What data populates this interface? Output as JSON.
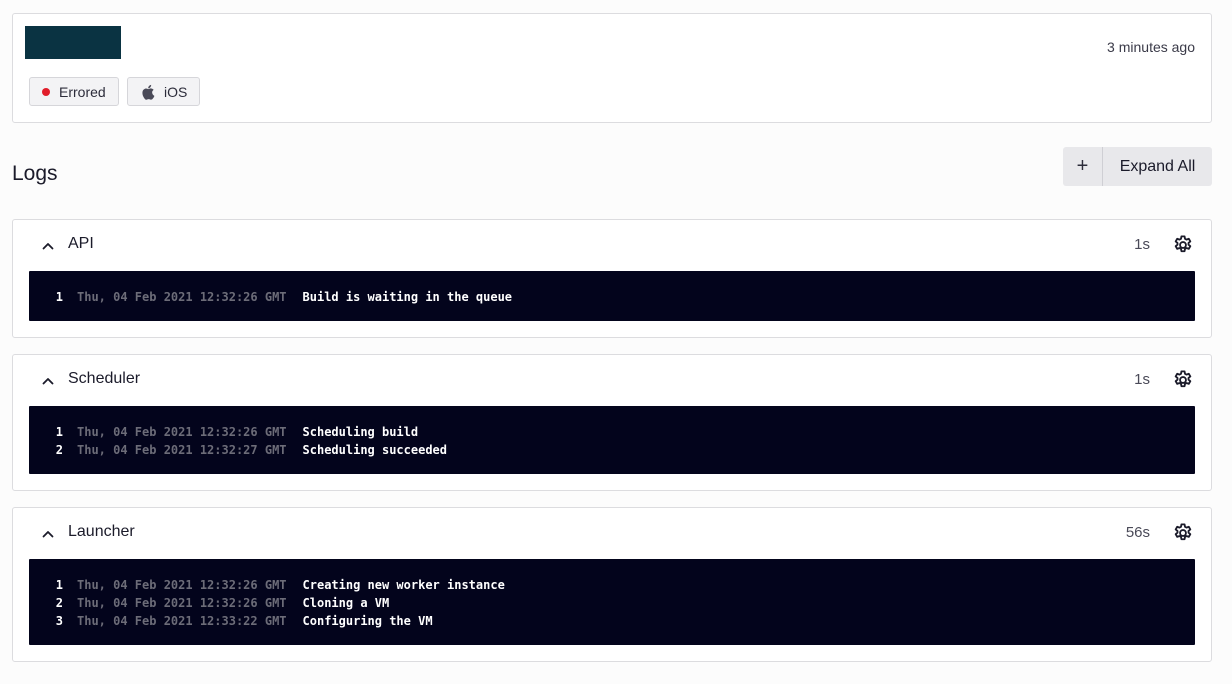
{
  "header": {
    "timestamp": "3 minutes ago",
    "status_badge": {
      "label": "Errored",
      "color": "#e11d2a"
    },
    "platform_badge": {
      "label": "iOS",
      "icon": "apple-icon"
    }
  },
  "logs": {
    "title": "Logs",
    "expand_all": {
      "icon": "+",
      "label": "Expand All"
    }
  },
  "sections": [
    {
      "title": "API",
      "duration": "1s",
      "lines": [
        {
          "num": "1",
          "time": "Thu, 04 Feb 2021 12:32:26 GMT",
          "message": "Build is waiting in the queue"
        }
      ]
    },
    {
      "title": "Scheduler",
      "duration": "1s",
      "lines": [
        {
          "num": "1",
          "time": "Thu, 04 Feb 2021 12:32:26 GMT",
          "message": "Scheduling build"
        },
        {
          "num": "2",
          "time": "Thu, 04 Feb 2021 12:32:27 GMT",
          "message": "Scheduling succeeded"
        }
      ]
    },
    {
      "title": "Launcher",
      "duration": "56s",
      "lines": [
        {
          "num": "1",
          "time": "Thu, 04 Feb 2021 12:32:26 GMT",
          "message": "Creating new worker instance"
        },
        {
          "num": "2",
          "time": "Thu, 04 Feb 2021 12:32:26 GMT",
          "message": "Cloning a VM"
        },
        {
          "num": "3",
          "time": "Thu, 04 Feb 2021 12:33:22 GMT",
          "message": "Configuring the VM"
        }
      ]
    }
  ]
}
